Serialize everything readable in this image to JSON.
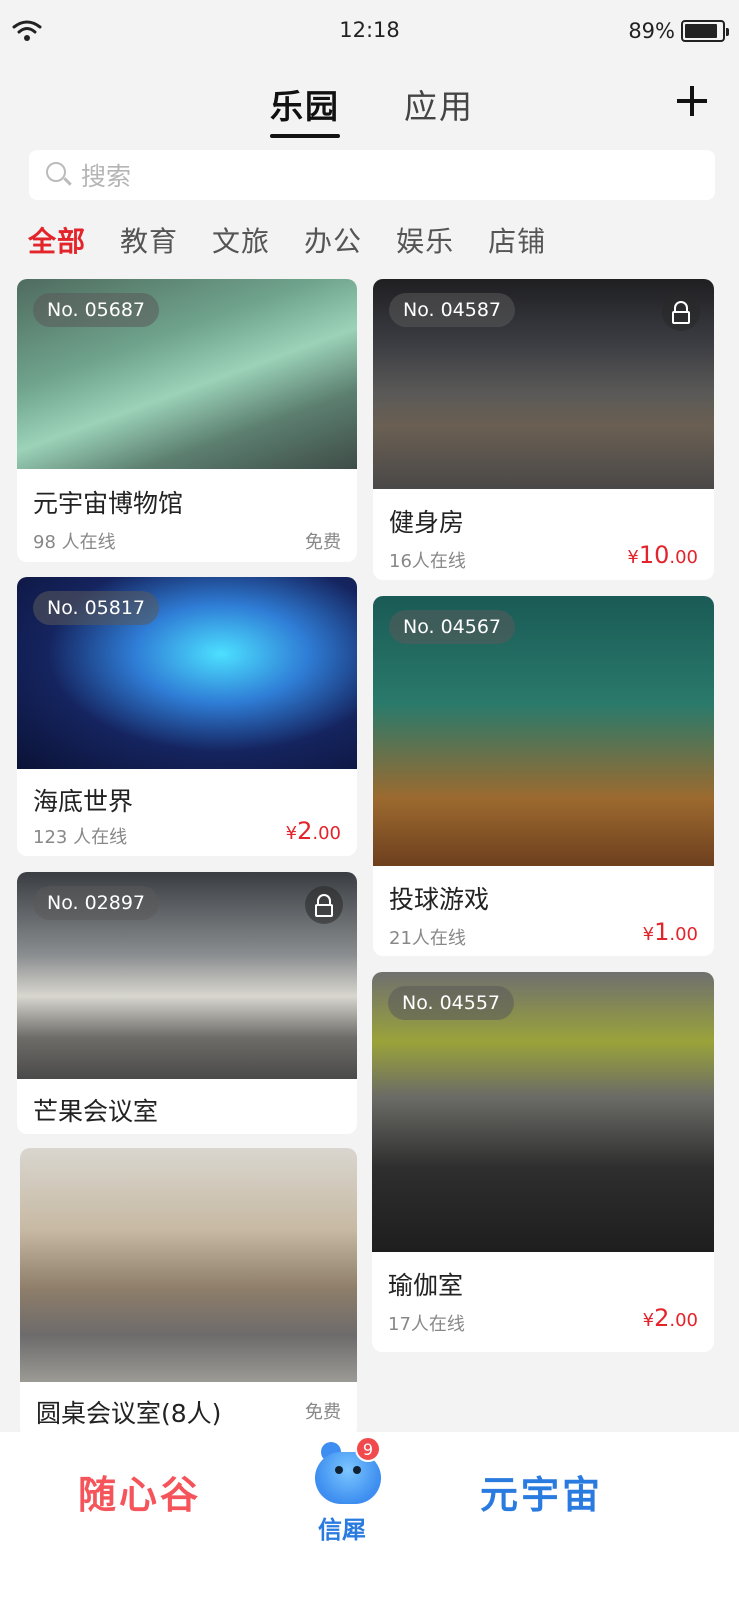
{
  "status_bar": {
    "time": "12:18",
    "battery": "89%",
    "battery_level": 0.89
  },
  "header": {
    "tab_active": "乐园",
    "tab_other": "应用"
  },
  "search": {
    "placeholder": "搜索"
  },
  "categories": [
    "全部",
    "教育",
    "文旅",
    "办公",
    "娱乐",
    "店铺"
  ],
  "cards": [
    {
      "no": "No. 05687",
      "title": "元宇宙博物馆",
      "online": "98 人在线",
      "price_free": "免费"
    },
    {
      "no": "No. 04587",
      "title": "健身房",
      "online": "16人在线",
      "price_symbol": "¥",
      "price_int": "10",
      "price_dec": ".00"
    },
    {
      "no": "No. 05817",
      "title": "海底世界",
      "online": "123 人在线",
      "price_symbol": "¥",
      "price_int": "2",
      "price_dec": ".00"
    },
    {
      "no": "No. 04567",
      "title": "投球游戏",
      "online": "21人在线",
      "price_symbol": "¥",
      "price_int": "1",
      "price_dec": ".00"
    },
    {
      "no": "No. 02897",
      "title": "芒果会议室"
    },
    {
      "no": "No. 04557",
      "title": "瑜伽室",
      "online": "17人在线",
      "price_symbol": "¥",
      "price_int": "2",
      "price_dec": ".00"
    },
    {
      "title": "圆桌会议室(8人)",
      "price_free": "免费"
    }
  ],
  "bottom_nav": {
    "left": "随心谷",
    "center_label": "信犀",
    "center_badge": "9",
    "right": "元宇宙"
  },
  "colors": {
    "accent_red": "#e3242b",
    "brand_blue": "#2a7be0",
    "brand_pink": "#f4545a"
  }
}
